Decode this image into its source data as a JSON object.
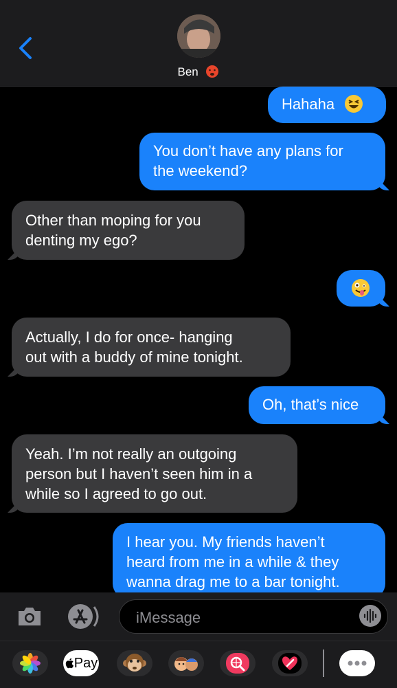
{
  "header": {
    "contact_name": "Ben"
  },
  "messages": [
    {
      "side": "out",
      "text": "Hahaha"
    },
    {
      "side": "out",
      "text": "You don’t have any plans for\nthe weekend?"
    },
    {
      "side": "in",
      "text": "Other than moping for you\ndenting my ego?"
    },
    {
      "side": "out",
      "text": ""
    },
    {
      "side": "in",
      "text": "Actually, I do for once- hanging\nout with a buddy of mine tonight."
    },
    {
      "side": "out",
      "text": "Oh, that’s nice"
    },
    {
      "side": "in",
      "text": "Yeah. I’m not really an outgoing\nperson but I haven’t seen him in a\nwhile so I agreed to go out."
    },
    {
      "side": "out",
      "text": "I hear you. My friends haven’t\nheard from me in a while & they\nwanna drag me to a bar tonight."
    }
  ],
  "composer": {
    "placeholder": "iMessage"
  },
  "app_drawer": {
    "apple_pay_label": "Pay"
  }
}
